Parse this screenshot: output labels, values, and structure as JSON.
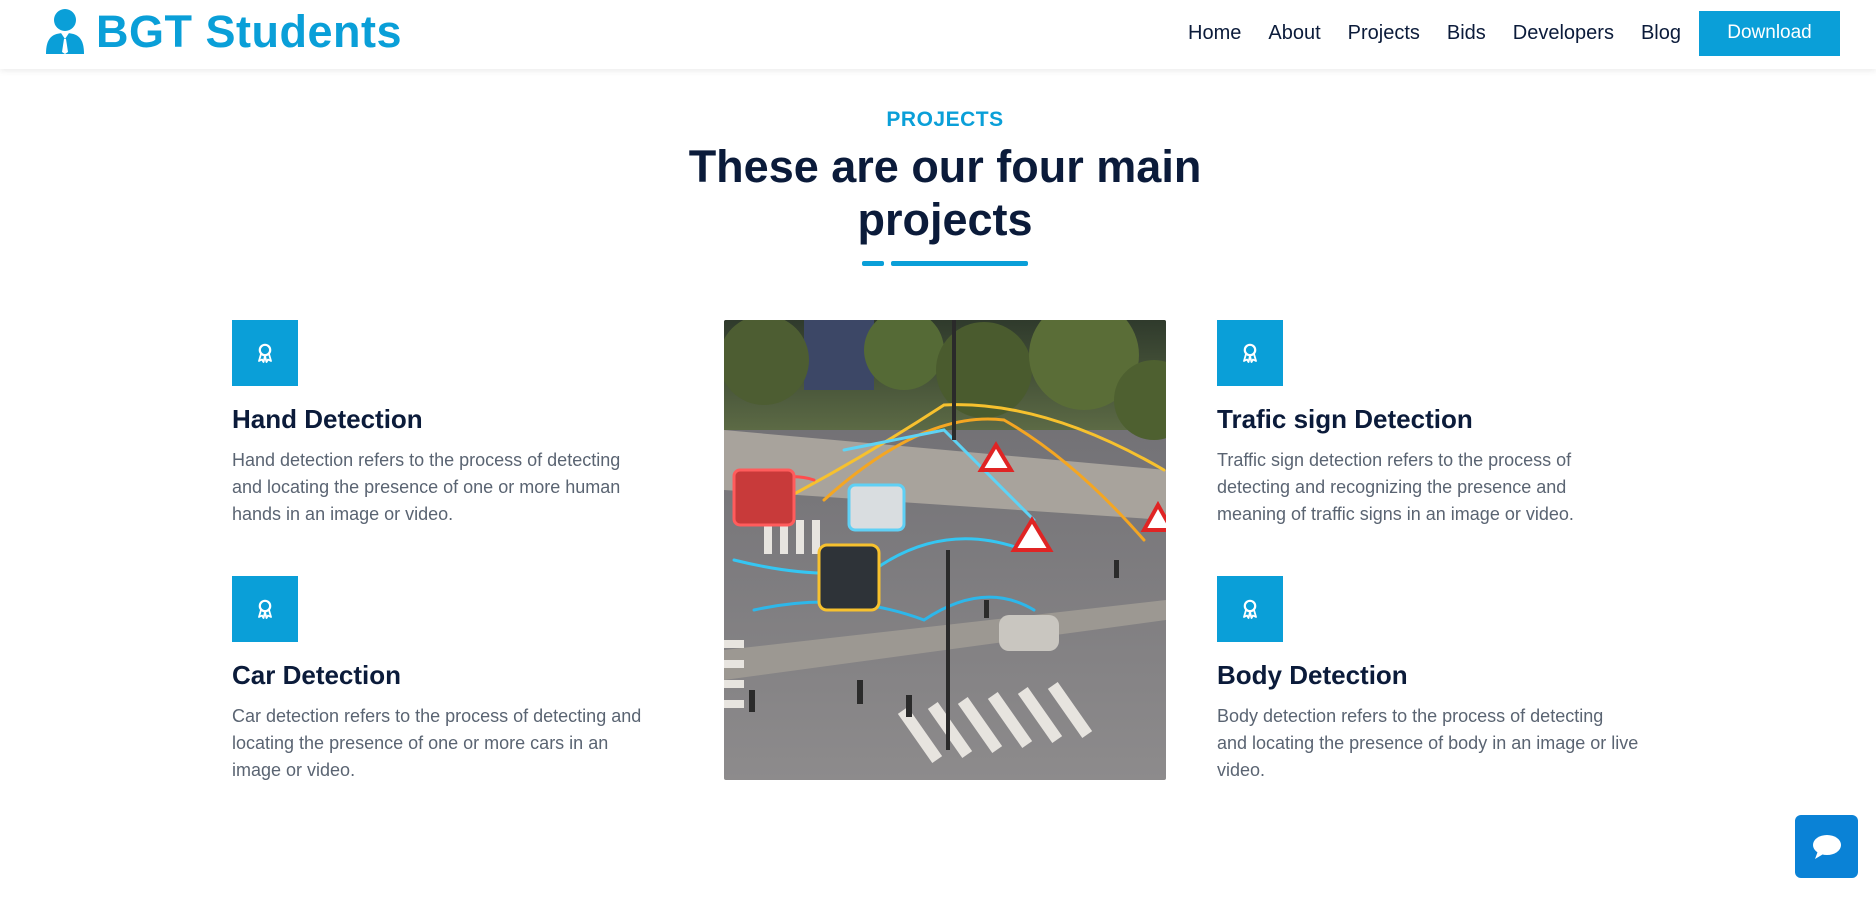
{
  "brand": {
    "name": "BGT Students",
    "icon": "student-avatar-icon"
  },
  "nav": {
    "links": [
      "Home",
      "About",
      "Projects",
      "Bids",
      "Developers",
      "Blog"
    ],
    "download_label": "Download"
  },
  "section": {
    "eyebrow": "PROJECTS",
    "headline_line1": "These are our four main",
    "headline_line2": "projects"
  },
  "features": [
    {
      "icon": "award-ribbon-icon",
      "title": "Hand Detection",
      "desc_lines": [
        "Hand detection refers to the process of detecting",
        "and locating the presence of one or more human",
        "hands in an image or video."
      ]
    },
    {
      "icon": "award-ribbon-icon",
      "title": "Car Detection",
      "desc_lines": [
        "Car detection refers to the process of detecting and",
        "locating the presence of one or more cars in an",
        "image or video."
      ]
    },
    {
      "icon": "award-ribbon-icon",
      "title": "Trafic sign Detection",
      "desc_lines": [
        "Traffic sign detection refers to the process of",
        "detecting and recognizing the presence and",
        "meaning of traffic signs in an image or video."
      ]
    },
    {
      "icon": "award-ribbon-icon",
      "title": "Body Detection",
      "desc_lines": [
        "Body detection refers to the process of detecting",
        "and locating the presence of body in an image or live",
        "video."
      ]
    }
  ],
  "illustration": {
    "subject": "smart-city-intersection-detection"
  },
  "chat": {
    "icon": "chat-bubble-icon"
  },
  "colors": {
    "accent": "#0a9fd8",
    "heading": "#0b1b3a",
    "body": "#5a6472",
    "chat": "#0a82d6"
  }
}
